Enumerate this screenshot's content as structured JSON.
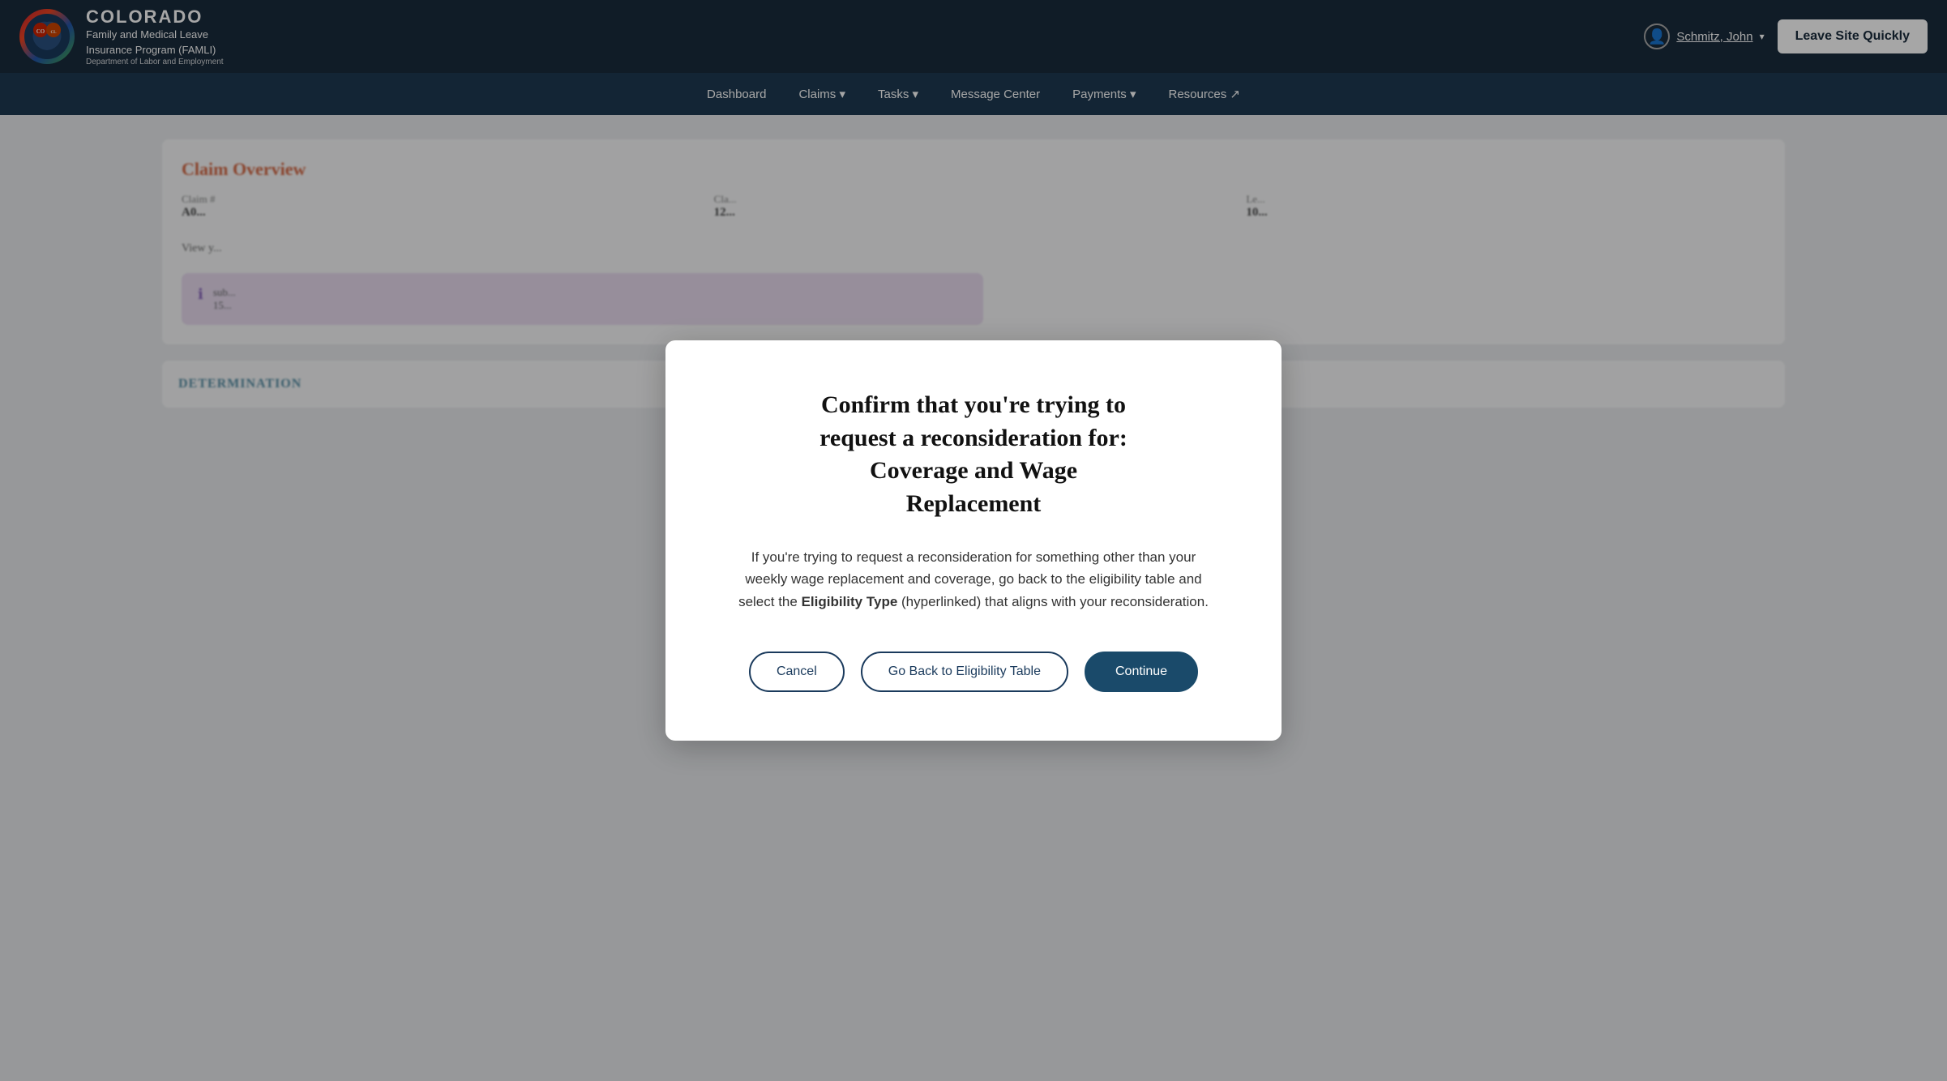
{
  "header": {
    "state_name": "COLORADO",
    "program_name": "Family and Medical Leave\nInsurance Program (FAMLI)",
    "dept_name": "Department of Labor and Employment",
    "user_name": "Schmitz, John",
    "leave_site_label": "Leave Site Quickly"
  },
  "nav": {
    "items": [
      {
        "label": "Dashboard"
      },
      {
        "label": "Claims ▾"
      },
      {
        "label": "Tasks ▾"
      },
      {
        "label": "Message Center"
      },
      {
        "label": "Payments ▾"
      },
      {
        "label": "Resources ↗"
      }
    ]
  },
  "background": {
    "claim_overview_title": "Claim Overview",
    "fields": [
      {
        "label": "Claim #",
        "value": "A0..."
      },
      {
        "label": "Cla...",
        "value": "12..."
      },
      {
        "label": "Le...",
        "value": "10..."
      }
    ],
    "view_text": "View y...",
    "determination_title": "DETERMINATION"
  },
  "modal": {
    "title": "Confirm that you're trying to\nrequest a reconsideration for:\nCoverage and Wage\nReplacement",
    "body_text": "If you're trying to request a reconsideration for something other than your weekly wage replacement and coverage, go back to the eligibility table and select the ",
    "body_bold": "Eligibility Type",
    "body_end": " (hyperlinked) that aligns with your reconsideration.",
    "cancel_label": "Cancel",
    "eligibility_label": "Go Back to Eligibility Table",
    "continue_label": "Continue"
  }
}
